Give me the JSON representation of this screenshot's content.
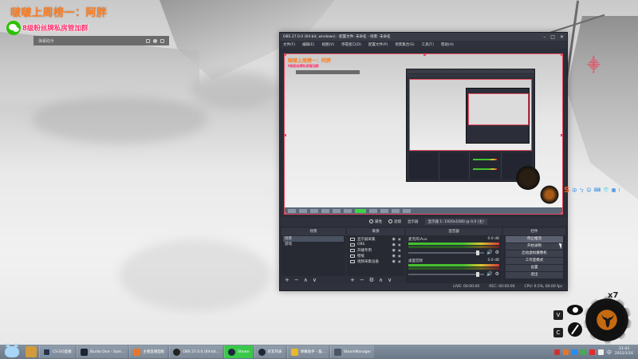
{
  "overlay": {
    "title": "啵啵上周榜一：阿胖",
    "wechat_text": "8级粉丝牌私房管加群",
    "danmaku_placeholder": "弹幕助手"
  },
  "obs": {
    "title": "OBS 27.0.0 (64-bit, windows) - 配置文件: 未命名 - 场景: 未命名",
    "window_controls": [
      "–",
      "□",
      "✕"
    ],
    "menu": [
      "文件(F)",
      "编辑(E)",
      "视图(V)",
      "停靠窗口(D)",
      "配置文件(P)",
      "场景集合(S)",
      "工具(T)",
      "帮助(H)"
    ],
    "preview": {
      "title": "啵啵上周榜一：阿胖",
      "wechat_text": "8级粉丝牌私房管加群"
    },
    "toolbar": {
      "properties": "属性",
      "filters": "滤镜",
      "scene_label": "显示器",
      "display_value": "显示器 1: 1920x1080 @ 0,0 (主)"
    },
    "docks": {
      "scenes": {
        "header": "场景",
        "items": [
          "场景",
          "游戏"
        ],
        "selected": 0
      },
      "sources": {
        "header": "来源",
        "items": [
          {
            "icon": "monitor-icon",
            "label": "显示器采集"
          },
          {
            "icon": "image-icon",
            "label": "OBS"
          },
          {
            "icon": "text-icon",
            "label": "开播专用"
          },
          {
            "icon": "image-icon",
            "label": "壁纸"
          },
          {
            "icon": "camera-icon",
            "label": "视频采集设备"
          }
        ]
      },
      "mixer": {
        "header": "混音器",
        "channels": [
          {
            "name": "麦克风/Aux",
            "db": "0.0 dB"
          },
          {
            "name": "桌面音频",
            "db": "0.0 dB"
          }
        ]
      },
      "controls": {
        "header": "控件",
        "buttons": [
          "停止推流",
          "开始录制",
          "启动虚拟摄像机",
          "工作室模式",
          "设置",
          "退出"
        ],
        "active_index": 0
      }
    },
    "footer_buttons": [
      "+",
      "−",
      "∧",
      "∨"
    ],
    "sources_footer_buttons": [
      "+",
      "−",
      "⚙",
      "∧",
      "∨"
    ],
    "status": {
      "live": "LIVE: 00:00:00",
      "rec": "REC: 00:00:00",
      "cpu": "CPU: 6.5%, 60.00 fps"
    }
  },
  "right_side": {
    "sogou_items": [
      "中",
      "ㄅ",
      "☺",
      "⌨",
      "👕",
      "▦",
      "⁞"
    ],
    "sogou_logo": "S",
    "badge_text": "x7",
    "v_btn": "V",
    "c_btn": "C"
  },
  "taskbar": {
    "items": [
      {
        "label": "CS:GO直播",
        "color": "#2a3444"
      },
      {
        "label": "Studio One - Sam...",
        "color": "#1c2333"
      },
      {
        "label": "主播直播面板",
        "color": "#e8762a"
      },
      {
        "label": "OBS 27.0.0 (64-bit...",
        "color": "#222"
      },
      {
        "label": "Steam",
        "color": "#1b2838",
        "active": true
      },
      {
        "label": "好友列表",
        "color": "#1b2838"
      },
      {
        "label": "弹幕助手 - 猫...",
        "color": "#e8b92a"
      },
      {
        "label": "SteamManager",
        "color": "#4a5666"
      }
    ],
    "tray_icons": [
      "#c33",
      "#e8762a",
      "#2a8be8",
      "#3fb04a",
      "#e82a2a",
      "#eee"
    ],
    "lang": "中",
    "time": "21:43",
    "date": "2022/1/16"
  }
}
